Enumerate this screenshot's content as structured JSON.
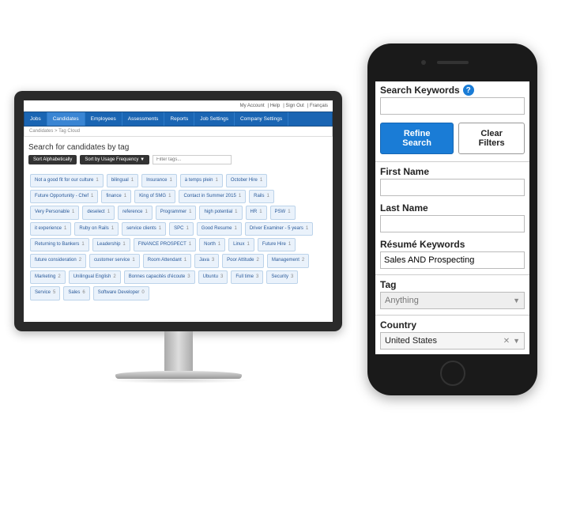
{
  "desktop": {
    "top_links": [
      "My Account",
      "Help",
      "Sign Out",
      "Français"
    ],
    "tabs": [
      "Jobs",
      "Candidates",
      "Employees",
      "Assessments",
      "Reports",
      "Job Settings",
      "Company Settings"
    ],
    "active_tab": 1,
    "breadcrumb": "Candidates > Tag Cloud",
    "title": "Search for candidates by tag",
    "sort_alpha": "Sort Alphabetically",
    "sort_freq": "Sort by Usage Frequency ▼",
    "filter_placeholder": "Filter tags...",
    "tags": [
      {
        "l": "Not a good fit for our culture",
        "c": 1
      },
      {
        "l": "bilingual",
        "c": 1
      },
      {
        "l": "Insurance",
        "c": 1
      },
      {
        "l": "à temps plein",
        "c": 1
      },
      {
        "l": "October Hire",
        "c": 1
      },
      {
        "l": "Future Opportunity - Chef",
        "c": 1
      },
      {
        "l": "finance",
        "c": 1
      },
      {
        "l": "King of SMG",
        "c": 1
      },
      {
        "l": "Contact in Summer 2015",
        "c": 1
      },
      {
        "l": "Rails",
        "c": 1
      },
      {
        "l": "Very Personable",
        "c": 1
      },
      {
        "l": "deselect",
        "c": 1
      },
      {
        "l": "reference",
        "c": 1
      },
      {
        "l": "Programmer",
        "c": 1
      },
      {
        "l": "high potential",
        "c": 1
      },
      {
        "l": "HR",
        "c": 1
      },
      {
        "l": "PSW",
        "c": 1
      },
      {
        "l": "it experience",
        "c": 1
      },
      {
        "l": "Ruby on Rails",
        "c": 1
      },
      {
        "l": "service clients",
        "c": 1
      },
      {
        "l": "SPC",
        "c": 1
      },
      {
        "l": "Good Resume",
        "c": 1
      },
      {
        "l": "Driver Examiner - 5 years",
        "c": 1
      },
      {
        "l": "Returning to Bankers",
        "c": 1
      },
      {
        "l": "Leadership",
        "c": 1
      },
      {
        "l": "FINANCE PROSPECT",
        "c": 1
      },
      {
        "l": "North",
        "c": 1
      },
      {
        "l": "Linux",
        "c": 1
      },
      {
        "l": "Future Hire",
        "c": 1
      },
      {
        "l": "future consideration",
        "c": 2
      },
      {
        "l": "customer service",
        "c": 1
      },
      {
        "l": "Room Attendant",
        "c": 1
      },
      {
        "l": "Java",
        "c": 3
      },
      {
        "l": "Poor Attitude",
        "c": 2
      },
      {
        "l": "Management",
        "c": 2
      },
      {
        "l": "Marketing",
        "c": 2
      },
      {
        "l": "Unilingual English",
        "c": 2
      },
      {
        "l": "Bonnes capacités d'écoute",
        "c": 3
      },
      {
        "l": "Ubuntu",
        "c": 3
      },
      {
        "l": "Full time",
        "c": 3
      },
      {
        "l": "Security",
        "c": 3
      },
      {
        "l": "Service",
        "c": 5
      },
      {
        "l": "Sales",
        "c": 6
      },
      {
        "l": "Software Developer",
        "c": 0
      }
    ]
  },
  "mobile": {
    "search_keywords_label": "Search Keywords",
    "refine_btn": "Refine Search",
    "clear_btn": "Clear Filters",
    "first_name_label": "First Name",
    "last_name_label": "Last Name",
    "resume_keywords_label": "Résumé Keywords",
    "resume_keywords_value": "Sales AND Prospecting",
    "tag_label": "Tag",
    "tag_placeholder": "Anything",
    "country_label": "Country",
    "country_value": "United States"
  }
}
